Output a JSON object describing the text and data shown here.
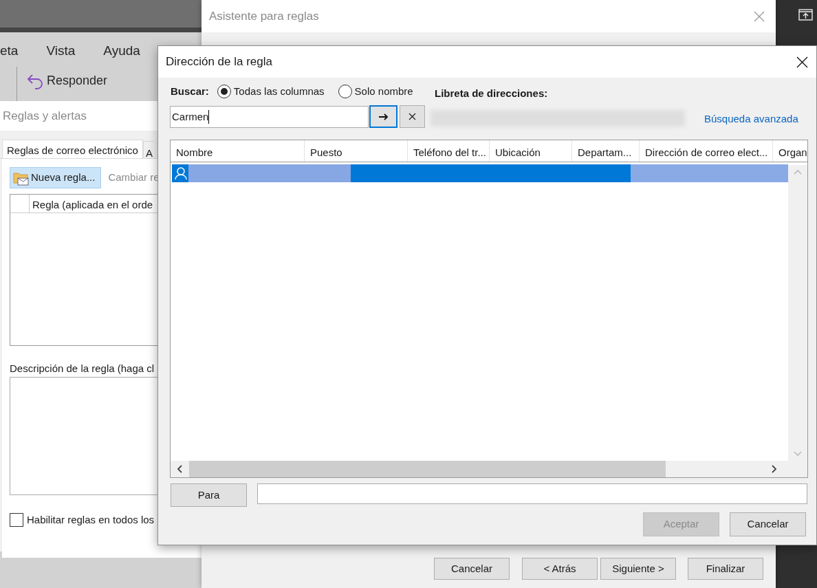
{
  "background_app": {
    "menu": [
      "eta",
      "Vista",
      "Ayuda"
    ],
    "ribbon_button": "Responder"
  },
  "rules_window": {
    "title": "Reglas y alertas",
    "tabs": [
      {
        "label": "Reglas de correo electrónico",
        "selected": true
      },
      {
        "label": "A",
        "selected": false
      }
    ],
    "toolbar": [
      {
        "label": "Nueva regla...",
        "disabled": false
      },
      {
        "label": "Cambiar re",
        "disabled": true
      }
    ],
    "list_header": "Regla (aplicada en el orde",
    "description_label": "Descripción de la regla (haga cl",
    "enable_checkbox": {
      "label": "Habilitar reglas en todos los",
      "checked": false
    }
  },
  "wizard": {
    "title": "Asistente para reglas",
    "buttons": [
      {
        "label": "Cancelar",
        "disabled": false
      },
      {
        "label": "< Atrás",
        "disabled": false
      },
      {
        "label": "Siguiente >",
        "disabled": false
      },
      {
        "label": "Finalizar",
        "disabled": false
      }
    ]
  },
  "dialog": {
    "title": "Dirección de la regla",
    "search_label": "Buscar:",
    "search_options": [
      {
        "label": "Todas las columnas",
        "selected": true
      },
      {
        "label": "Solo nombre",
        "selected": false
      }
    ],
    "address_book_label": "Libreta de direcciones:",
    "search_value": "Carmen",
    "advanced_link": "Búsqueda avanzada",
    "table": {
      "columns": [
        "Nombre",
        "Puesto",
        "Teléfono del tr...",
        "Ubicación",
        "Departam...",
        "Dirección de correo elect...",
        "Organ"
      ],
      "rows": [
        {
          "selected": true
        }
      ]
    },
    "to_button": "Para",
    "buttons": [
      {
        "label": "Aceptar",
        "disabled": true
      },
      {
        "label": "Cancelar",
        "disabled": false
      }
    ]
  }
}
